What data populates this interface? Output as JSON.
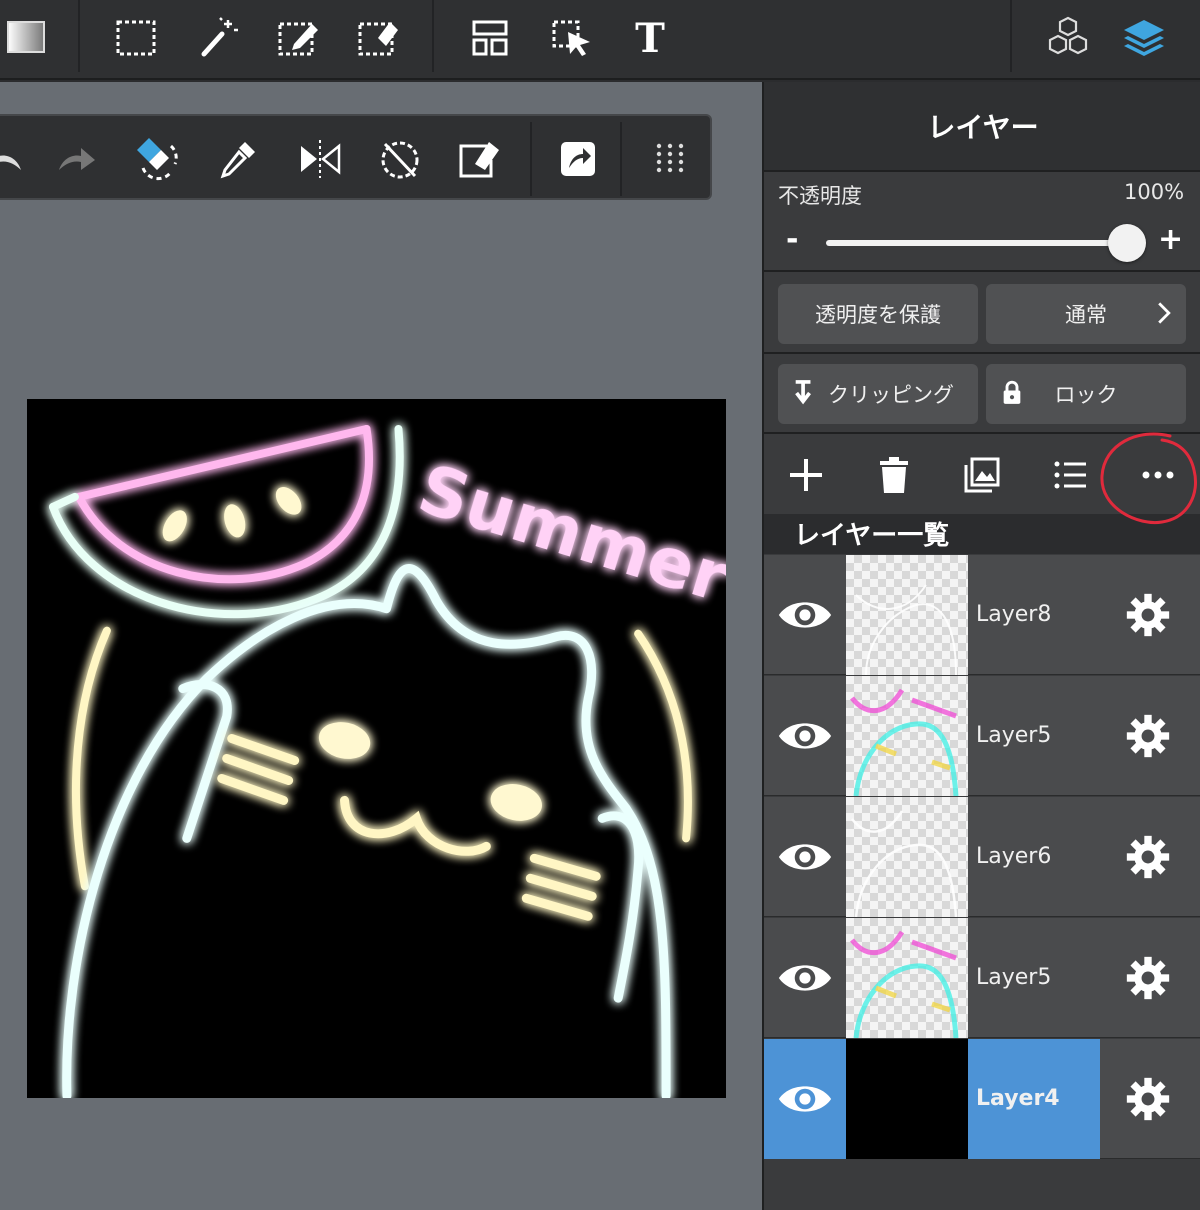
{
  "toolbar": {
    "tools": [
      {
        "name": "gradient-swatch-icon"
      },
      {
        "name": "select-rect-icon"
      },
      {
        "name": "magic-wand-icon"
      },
      {
        "name": "select-pen-icon"
      },
      {
        "name": "select-eraser-icon"
      },
      {
        "name": "layout-icon"
      },
      {
        "name": "move-cursor-icon"
      },
      {
        "name": "text-tool-icon",
        "glyph": "T"
      },
      {
        "name": "materials-cubes-icon"
      },
      {
        "name": "layers-icon"
      }
    ],
    "active_color": "#3fa6e0"
  },
  "subtoolbar": {
    "tools": [
      "undo-icon",
      "redo-icon",
      "eraser-swap-icon",
      "eyedropper-icon",
      "flip-icon",
      "rotate-reset-icon",
      "edit-eraser-icon",
      "share-icon",
      "grid-dots-icon"
    ]
  },
  "artwork": {
    "text": "Summer",
    "neon_colors": {
      "cyan": "#3ff0e6",
      "magenta": "#f04ad6",
      "yellow": "#f2d640",
      "white": "#ffffff"
    }
  },
  "panel": {
    "title": "レイヤー",
    "opacity_label": "不透明度",
    "opacity_value": "100%",
    "opacity_fraction": 1.0,
    "minus": "-",
    "plus": "+",
    "protect_alpha": "透明度を保護",
    "blend_mode": "通常",
    "clipping": "クリッピング",
    "lock": "ロック",
    "list_title": "レイヤー一覧",
    "layers": [
      {
        "name": "Layer8",
        "visible": true,
        "selected": false
      },
      {
        "name": "Layer5",
        "visible": true,
        "selected": false
      },
      {
        "name": "Layer6",
        "visible": true,
        "selected": false
      },
      {
        "name": "Layer5",
        "visible": true,
        "selected": false
      },
      {
        "name": "Layer4",
        "visible": true,
        "selected": true
      }
    ],
    "selected_color": "#4d93d6"
  }
}
